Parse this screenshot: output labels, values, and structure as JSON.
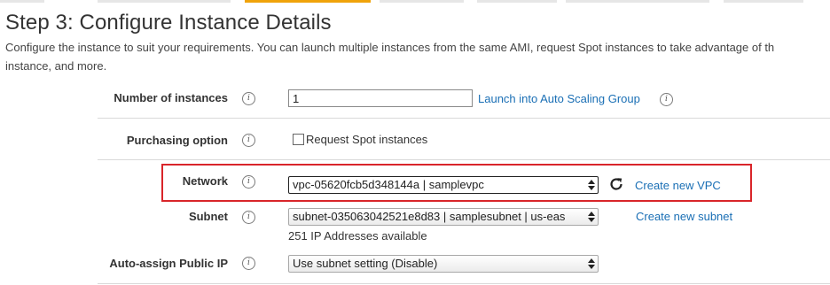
{
  "wizard": {
    "tabs": [
      {
        "name": "tab-1",
        "active": false
      },
      {
        "name": "tab-2",
        "active": false
      },
      {
        "name": "tab-3",
        "active": true
      },
      {
        "name": "tab-4",
        "active": false
      },
      {
        "name": "tab-5",
        "active": false
      },
      {
        "name": "tab-6",
        "active": false
      },
      {
        "name": "tab-7",
        "active": false
      }
    ],
    "title": "Step 3: Configure Instance Details",
    "description_line1": "Configure the instance to suit your requirements. You can launch multiple instances from the same AMI, request Spot instances to take advantage of th",
    "description_line2": "instance, and more."
  },
  "form": {
    "number_of_instances": {
      "label": "Number of instances",
      "value": "1",
      "link": "Launch into Auto Scaling Group"
    },
    "purchasing_option": {
      "label": "Purchasing option",
      "checkbox_label": "Request Spot instances",
      "checked": false
    },
    "network": {
      "label": "Network",
      "selected": "vpc-05620fcb5d348144a | samplevpc",
      "link": "Create new VPC"
    },
    "subnet": {
      "label": "Subnet",
      "selected": "subnet-035063042521e8d83 | samplesubnet | us-eas",
      "available": "251 IP Addresses available",
      "link": "Create new subnet"
    },
    "auto_assign_public_ip": {
      "label": "Auto-assign Public IP",
      "selected": "Use subnet setting (Disable)"
    }
  },
  "icons": {
    "info": "info-icon",
    "refresh": "refresh-icon",
    "select_arrows": "select-arrows-icon"
  },
  "colors": {
    "active_tab": "#f0a30a",
    "link": "#1a6fb5",
    "highlight": "#d9252a"
  }
}
